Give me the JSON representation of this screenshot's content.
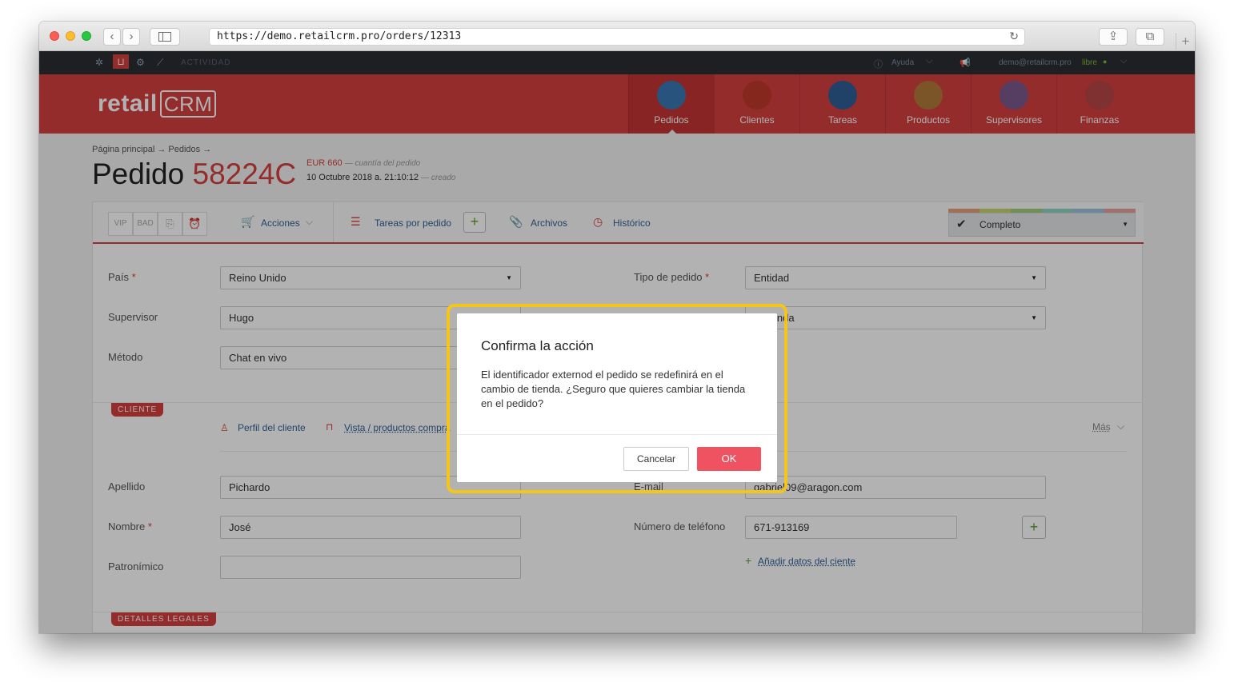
{
  "browser": {
    "url": "https://demo.retailcrm.pro/orders/12313",
    "back_glyph": "‹",
    "forward_glyph": "›",
    "reload_glyph": "↻",
    "share_glyph": "⇪",
    "tabs_glyph": "⧉",
    "new_tab_glyph": "+"
  },
  "topbar": {
    "activity": "ACTIVIDAD",
    "help": "Ayuda",
    "user_email": "demo@retailcrm.pro",
    "user_status": "libre"
  },
  "header": {
    "logo_text": "retail",
    "logo_crm": "CRM",
    "nav": [
      {
        "label": "Pedidos",
        "icon": "cart-icon",
        "color": "#3a78b4"
      },
      {
        "label": "Clientes",
        "icon": "client-avatar-icon",
        "color": "#c0392b"
      },
      {
        "label": "Tareas",
        "icon": "tasks-icon",
        "color": "#2f5f96"
      },
      {
        "label": "Productos",
        "icon": "box-icon",
        "color": "#b07a3a"
      },
      {
        "label": "Supervisores",
        "icon": "supervisor-avatar-icon",
        "color": "#7a5a8c"
      },
      {
        "label": "Finanzas",
        "icon": "finance-icon",
        "color": "#b74545"
      }
    ]
  },
  "page": {
    "breadcrumb": "Página principal → Pedidos →",
    "title_word": "Pedido",
    "order_number": "58224C",
    "amount": "EUR 660",
    "amount_note": "— cuantía del pedido",
    "created_date": "10 Octubre 2018 a. 21:10:12",
    "created_note": "— creado"
  },
  "toolbar": {
    "tags": [
      "VIP",
      "BAD"
    ],
    "actions": "Acciones",
    "tasks": "Tareas por pedido",
    "files": "Archivos",
    "history": "Histórico",
    "status": "Completo",
    "status_colors": [
      "#e6a07a",
      "#c9d36b",
      "#9fcf7a",
      "#8fd1c4",
      "#9cc0e0",
      "#e8a0a0"
    ]
  },
  "form": {
    "country_label": "País",
    "country_value": "Reino Unido",
    "supervisor_label": "Supervisor",
    "supervisor_value": "Hugo",
    "method_label": "Método",
    "method_value": "Chat en vivo",
    "order_type_label": "Tipo de pedido",
    "order_type_value": "Entidad",
    "store_value": "ra tienda"
  },
  "client": {
    "section": "CLIENTE",
    "profile_link": "Perfil del cliente",
    "products_link": "Vista / productos compra",
    "more": "Más",
    "lastname_label": "Apellido",
    "lastname_value": "Pichardo",
    "firstname_label": "Nombre",
    "firstname_value": "José",
    "patronymic_label": "Patronímico",
    "patronymic_value": "",
    "email_label": "E-mail",
    "email_value": "gabriel09@aragon.com",
    "phone_label": "Número de teléfono",
    "phone_value": "671-913169",
    "add_client_data": "Añadir datos del ciente"
  },
  "legal": {
    "section": "DETALLES LEGALES"
  },
  "modal": {
    "title": "Confirma la acción",
    "body": "El identificador externod el pedido se redefinirá en el cambio de tienda. ¿Seguro que quieres cambiar la tienda en el pedido?",
    "cancel": "Cancelar",
    "ok": "OK",
    "highlight_color": "#f5c518"
  }
}
